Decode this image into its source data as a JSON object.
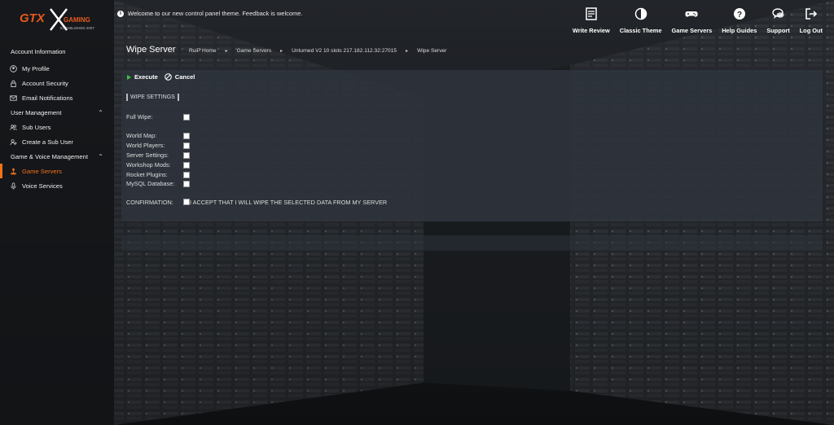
{
  "header": {
    "logo_text": "GTX",
    "logo_sub": "GAMING",
    "logo_tag": "ESTABLISHED 2007",
    "welcome": "Welcome to our new control panel theme. Feedback is welcome.",
    "nav": [
      {
        "label": "Write Review",
        "icon": "review-icon"
      },
      {
        "label": "Classic Theme",
        "icon": "contrast-icon"
      },
      {
        "label": "Game Servers",
        "icon": "gamepad-icon"
      },
      {
        "label": "Help Guides",
        "icon": "help-icon"
      },
      {
        "label": "Support",
        "icon": "chat-icon"
      },
      {
        "label": "Log Out",
        "icon": "logout-icon"
      }
    ]
  },
  "sidebar": {
    "account_heading": "Account Information",
    "account_items": [
      {
        "label": "My Profile",
        "icon": "profile-icon"
      },
      {
        "label": "Account Security",
        "icon": "lock-icon"
      },
      {
        "label": "Email Notifications",
        "icon": "mail-icon"
      }
    ],
    "user_heading": "User Management",
    "user_items": [
      {
        "label": "Sub Users",
        "icon": "users-icon"
      },
      {
        "label": "Create a Sub User",
        "icon": "add-user-icon"
      }
    ],
    "game_heading": "Game & Voice Management",
    "game_items": [
      {
        "label": "Game Servers",
        "icon": "joystick-icon",
        "active": true
      },
      {
        "label": "Voice Services",
        "icon": "microphone-icon"
      }
    ]
  },
  "page": {
    "title": "Wipe Server",
    "breadcrumb": [
      "RuiP Home",
      "Game Servers",
      "Unturned V2 10 slots 217.182.112.32:27015",
      "Wipe Server"
    ]
  },
  "actions": {
    "execute": "Execute",
    "cancel": "Cancel"
  },
  "form": {
    "section": "WIPE SETTINGS",
    "full_wipe": "Full Wipe:",
    "options": [
      "World Map:",
      "World Players:",
      "Server Settings:",
      "Workshop Mods:",
      "Rocket Plugins:",
      "MySQL Database:"
    ],
    "confirmation_label": "CONFIRMATION:",
    "confirmation_text": "I ACCEPT THAT I WILL WIPE THE SELECTED DATA FROM MY SERVER"
  },
  "colors": {
    "accent": "#f2721c",
    "panel": "#2e333c",
    "execute": "#3ec43e"
  }
}
